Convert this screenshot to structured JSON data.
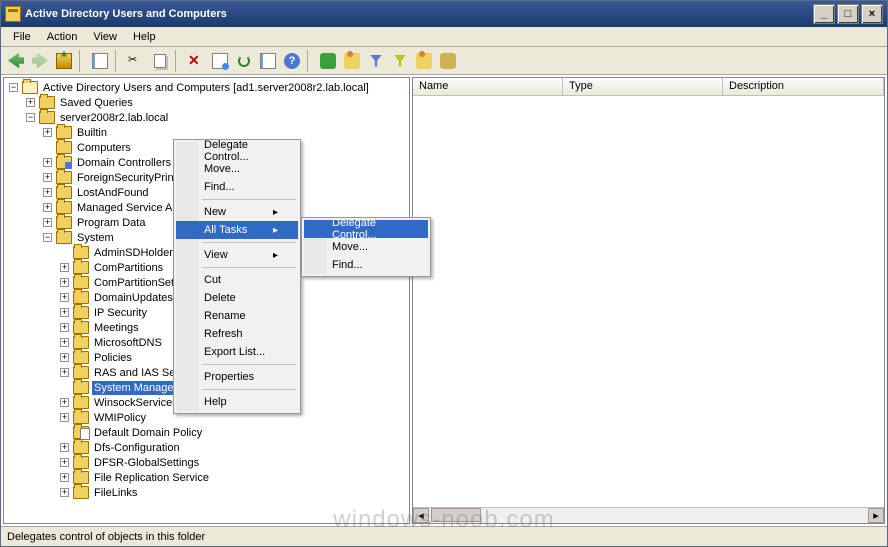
{
  "window": {
    "title": "Active Directory Users and Computers"
  },
  "menubar": [
    "File",
    "Action",
    "View",
    "Help"
  ],
  "list_columns": [
    "Name",
    "Type",
    "Description"
  ],
  "status": "Delegates control of objects in this folder",
  "watermark": "windows-noob.com",
  "tree": {
    "root": "Active Directory Users and Computers [ad1.server2008r2.lab.local]",
    "saved": "Saved Queries",
    "domain": "server2008r2.lab.local",
    "nodes1": [
      {
        "l": "Builtin",
        "exp": true,
        "b": "+"
      },
      {
        "l": "Computers",
        "exp": false,
        "b": ""
      },
      {
        "l": "Domain Controllers",
        "exp": true,
        "b": "+",
        "blue": true
      },
      {
        "l": "ForeignSecurityPrinci",
        "exp": true,
        "b": "+"
      },
      {
        "l": "LostAndFound",
        "exp": true,
        "b": "+"
      },
      {
        "l": "Managed Service Acc",
        "exp": true,
        "b": "+"
      },
      {
        "l": "Program Data",
        "exp": true,
        "b": "+"
      },
      {
        "l": "System",
        "exp": true,
        "b": "−",
        "open": true
      }
    ],
    "system_children": [
      {
        "l": "AdminSDHolder",
        "b": ""
      },
      {
        "l": "ComPartitions",
        "b": "+"
      },
      {
        "l": "ComPartitionSets",
        "b": "+"
      },
      {
        "l": "DomainUpdates",
        "b": "+"
      },
      {
        "l": "IP Security",
        "b": "+"
      },
      {
        "l": "Meetings",
        "b": "+"
      },
      {
        "l": "MicrosoftDNS",
        "b": "+"
      },
      {
        "l": "Policies",
        "b": "+"
      },
      {
        "l": "RAS and IAS Ser",
        "b": "+"
      },
      {
        "l": "System Management",
        "b": "",
        "sel": true
      },
      {
        "l": "WinsockServices",
        "b": "+"
      },
      {
        "l": "WMIPolicy",
        "b": "+"
      },
      {
        "l": "Default Domain Policy",
        "b": "",
        "doc": true
      },
      {
        "l": "Dfs-Configuration",
        "b": "+"
      },
      {
        "l": "DFSR-GlobalSettings",
        "b": "+"
      },
      {
        "l": "File Replication Service",
        "b": "+"
      },
      {
        "l": "FileLinks",
        "b": "+"
      }
    ]
  },
  "ctx1": {
    "items": [
      {
        "l": "Delegate Control...",
        "sub": false
      },
      {
        "l": "Move...",
        "sub": false
      },
      {
        "l": "Find...",
        "sub": false
      },
      {
        "sep": true
      },
      {
        "l": "New",
        "sub": true
      },
      {
        "l": "All Tasks",
        "sub": true,
        "hl": true
      },
      {
        "sep": true
      },
      {
        "l": "View",
        "sub": true
      },
      {
        "sep": true
      },
      {
        "l": "Cut",
        "sub": false
      },
      {
        "l": "Delete",
        "sub": false
      },
      {
        "l": "Rename",
        "sub": false
      },
      {
        "l": "Refresh",
        "sub": false
      },
      {
        "l": "Export List...",
        "sub": false
      },
      {
        "sep": true
      },
      {
        "l": "Properties",
        "sub": false
      },
      {
        "sep": true
      },
      {
        "l": "Help",
        "sub": false
      }
    ]
  },
  "ctx2": {
    "items": [
      {
        "l": "Delegate Control...",
        "hl": true
      },
      {
        "l": "Move..."
      },
      {
        "l": "Find..."
      }
    ]
  }
}
